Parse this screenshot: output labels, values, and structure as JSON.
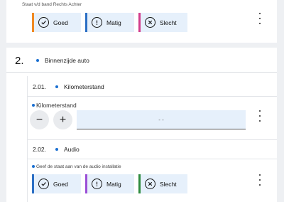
{
  "top": {
    "caption": "Staat v/d band Rechts Achter",
    "ratings": [
      "Goed",
      "Matig",
      "Slecht"
    ]
  },
  "section": {
    "number": "2.",
    "title": "Binnenzijde auto"
  },
  "km": {
    "number": "2.01.",
    "title": "Kilometerstand",
    "field_label": "Kilometerstand",
    "minus": "−",
    "plus": "+",
    "placeholder": "- -"
  },
  "audio": {
    "number": "2.02.",
    "title": "Audio",
    "caption": "Geef de staat aan van de audio installatie",
    "ratings": [
      "Goed",
      "Matig",
      "Slecht"
    ]
  },
  "colors": {
    "accent_blue": "#1a6fd1",
    "button_bg": "#e6f0fb",
    "goed_top": "#f08a24",
    "matig_top": "#2c6fc4",
    "slecht_top": "#d23c8c",
    "goed_audio": "#2c6fc4",
    "matig_audio": "#9b4fd6",
    "slecht_audio": "#2e8b3e"
  },
  "icons": {
    "goed": "check-circle-icon",
    "matig": "exclamation-circle-icon",
    "slecht": "x-circle-icon",
    "menu": "kebab-menu-icon"
  }
}
